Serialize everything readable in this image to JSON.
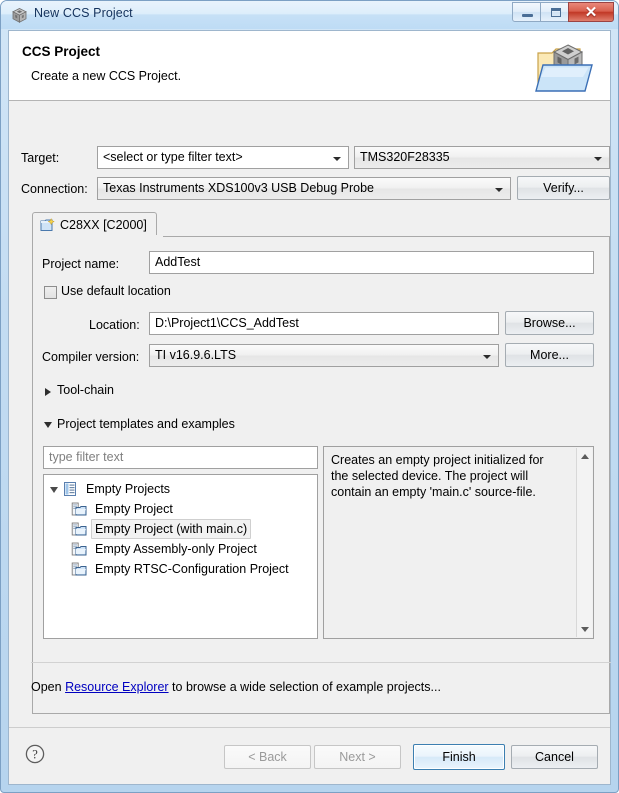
{
  "window": {
    "title": "New CCS Project",
    "icon": "cube-icon",
    "buttons": {
      "minimize": "minimize-icon",
      "maximize": "maximize-icon",
      "close": "✕"
    }
  },
  "header": {
    "title": "CCS Project",
    "subtitle": "Create a new CCS Project.",
    "banner_icon": "folder-cube-icon"
  },
  "fields": {
    "target_label": "Target:",
    "target_filter_value": "<select or type filter text>",
    "target_device_value": "TMS320F28335",
    "connection_label": "Connection:",
    "connection_value": "Texas Instruments XDS100v3 USB Debug Probe",
    "verify_button": "Verify..."
  },
  "tab": {
    "label": "C28XX [C2000]",
    "icon": "new-project-icon"
  },
  "project": {
    "name_label": "Project name:",
    "name_value": "AddTest",
    "use_default_location_label": "Use default location",
    "use_default_location_checked": false,
    "location_label": "Location:",
    "location_value": "D:\\Project1\\CCS_AddTest",
    "browse_button": "Browse...",
    "compiler_label": "Compiler version:",
    "compiler_value": "TI v16.9.6.LTS",
    "more_button": "More..."
  },
  "sections": {
    "toolchain_label": "Tool-chain",
    "toolchain_expanded": false,
    "templates_label": "Project templates and examples",
    "templates_expanded": true
  },
  "templates": {
    "filter_placeholder": "type filter text",
    "filter_value": "",
    "tree": [
      {
        "label": "Empty Projects",
        "level": 0,
        "icon": "document-list-icon",
        "expanded": true,
        "selected": false
      },
      {
        "label": "Empty Project",
        "level": 1,
        "icon": "project-folder-icon",
        "selected": false
      },
      {
        "label": "Empty Project (with main.c)",
        "level": 1,
        "icon": "project-folder-icon",
        "selected": true
      },
      {
        "label": "Empty Assembly-only Project",
        "level": 1,
        "icon": "project-folder-icon",
        "selected": false
      },
      {
        "label": "Empty RTSC-Configuration Project",
        "level": 1,
        "icon": "project-folder-icon",
        "selected": false
      }
    ],
    "description": "Creates an empty project initialized for the selected device. The project will contain an empty 'main.c' source-file."
  },
  "resource_line": {
    "prefix": "Open ",
    "link": "Resource Explorer",
    "suffix": " to browse a wide selection of example projects..."
  },
  "footer": {
    "help_icon": "help-icon",
    "back_button": "< Back",
    "back_disabled": true,
    "next_button": "Next >",
    "next_disabled": true,
    "finish_button": "Finish",
    "cancel_button": "Cancel"
  },
  "colors": {
    "titlebar": "#c6e0f6",
    "close_button": "#c13826",
    "link": "#0000c0",
    "default_button_border": "#3c7fb1",
    "dialog_background": "#f0f0f0"
  }
}
